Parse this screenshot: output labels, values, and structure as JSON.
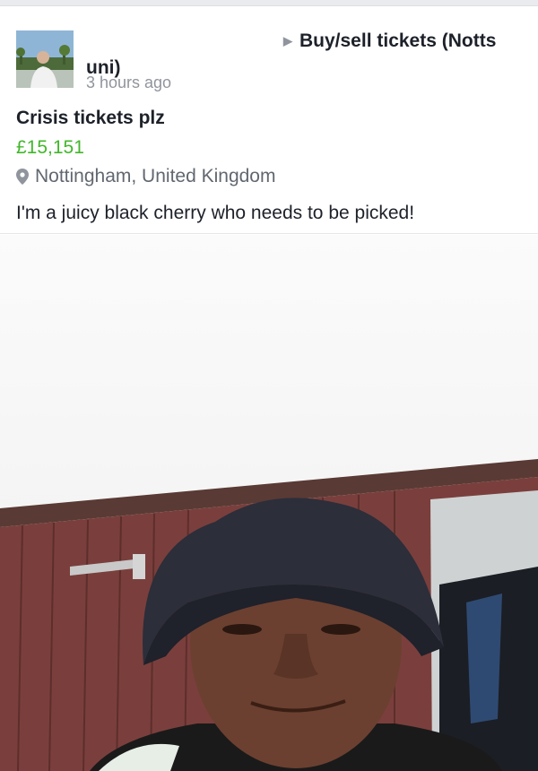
{
  "post": {
    "group_name": "Buy/sell tickets (Notts uni)",
    "timestamp": "3 hours ago",
    "title": "Crisis tickets plz",
    "price": "£15,151",
    "location": "Nottingham, United Kingdom",
    "description": "I'm a juicy black cherry who needs to be picked!"
  },
  "icons": {
    "group_arrow": "triangle-right-icon",
    "location": "map-pin-icon"
  },
  "colors": {
    "price": "#42b72a",
    "meta": "#90949c",
    "location": "#616770",
    "text": "#1d2129"
  }
}
